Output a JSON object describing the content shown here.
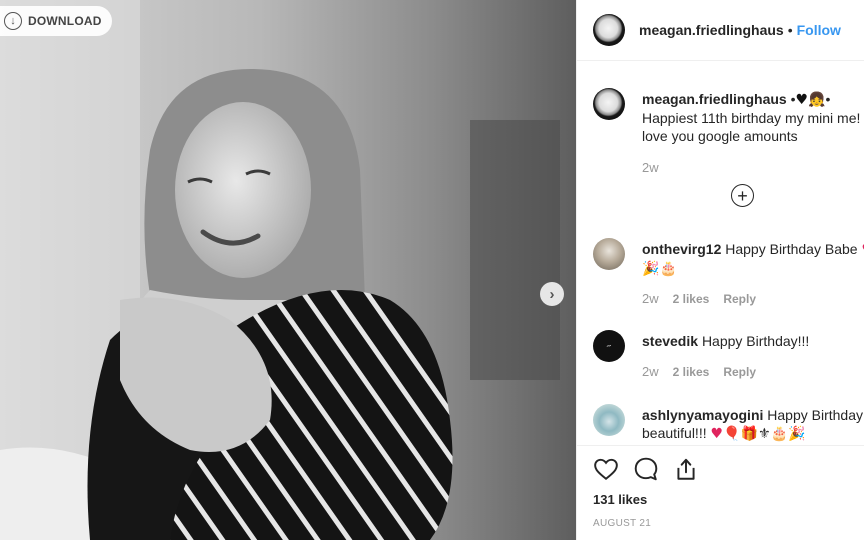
{
  "photo": {
    "download_label": "DOWNLOAD"
  },
  "post": {
    "username": "meagan.friedlinghaus",
    "follow_label": "Follow",
    "caption_user": "meagan.friedlinghaus",
    "caption_text": "Happiest 11th birthday my mini me!",
    "caption_text_2": "love you google amounts",
    "caption_time": "2w"
  },
  "comments": [
    {
      "user": "onthevirg12",
      "text": "Happy Birthday Babe",
      "time": "2w",
      "likes": "2 likes",
      "reply": "Reply"
    },
    {
      "user": "stevedik",
      "text": "Happy Birthday!!!",
      "time": "2w",
      "likes": "2 likes",
      "reply": "Reply"
    },
    {
      "user": "ashlynyamayogini",
      "text": "Happy Birthday",
      "text_2": "beautiful!!!"
    }
  ],
  "stats": {
    "likes": "131 likes",
    "date": "AUGUST 21"
  },
  "colors": {
    "link_blue": "#3897f0",
    "text": "#262626",
    "muted": "#999999",
    "border": "#efefef"
  },
  "icons": {
    "download": "download-icon",
    "next": "chevron-right-icon",
    "like": "heart-icon",
    "comment": "comment-icon",
    "share": "share-icon",
    "load_more": "plus-circle-icon"
  }
}
